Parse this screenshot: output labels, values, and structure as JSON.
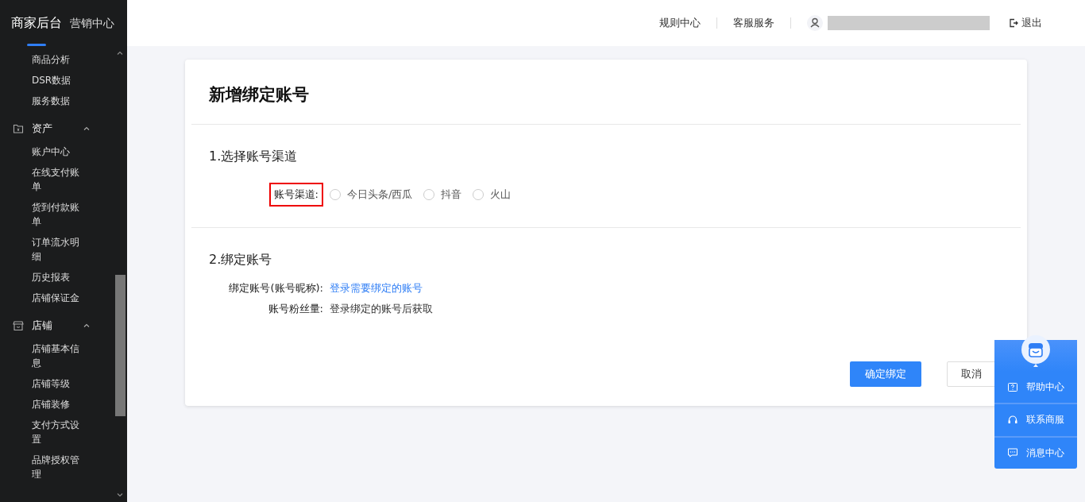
{
  "top_tabs": [
    {
      "label": "商家后台",
      "selected": true
    },
    {
      "label": "营销中心",
      "selected": false
    }
  ],
  "sidebar": {
    "items": [
      {
        "label": "商品分析"
      },
      {
        "label": "DSR数据"
      },
      {
        "label": "服务数据"
      }
    ],
    "groups": [
      {
        "label": "资产",
        "expanded": true,
        "children": [
          {
            "label": "账户中心"
          },
          {
            "label": "在线支付账单"
          },
          {
            "label": "货到付款账单"
          },
          {
            "label": "订单流水明细"
          },
          {
            "label": "历史报表"
          },
          {
            "label": "店铺保证金"
          }
        ]
      },
      {
        "label": "店铺",
        "expanded": true,
        "children": [
          {
            "label": "店铺基本信息"
          },
          {
            "label": "店铺等级"
          },
          {
            "label": "店铺装修"
          },
          {
            "label": "支付方式设置"
          },
          {
            "label": "品牌授权管理"
          }
        ]
      }
    ]
  },
  "header": {
    "links": [
      "规则中心",
      "客服服务"
    ],
    "logout": "退出"
  },
  "card": {
    "title": "新增绑定账号",
    "section1": {
      "title": "1.选择账号渠道",
      "label": "账号渠道:",
      "highlighted": true,
      "options": [
        {
          "label": "今日头条/西瓜",
          "selected": false
        },
        {
          "label": "抖音",
          "selected": false
        },
        {
          "label": "火山",
          "selected": false
        }
      ]
    },
    "section2": {
      "title": "2.绑定账号",
      "rows": [
        {
          "label": "绑定账号(账号昵称):",
          "value": "登录需要绑定的账号",
          "kind": "link"
        },
        {
          "label": "账号粉丝量:",
          "value": "登录绑定的账号后获取",
          "kind": "text"
        }
      ]
    },
    "buttons": [
      {
        "label": "确定绑定",
        "kind": "primary"
      },
      {
        "label": "取消",
        "kind": "default"
      }
    ]
  },
  "help_widget": {
    "items": [
      {
        "label": "帮助中心"
      },
      {
        "label": "联系商服"
      },
      {
        "label": "消息中心"
      }
    ]
  }
}
